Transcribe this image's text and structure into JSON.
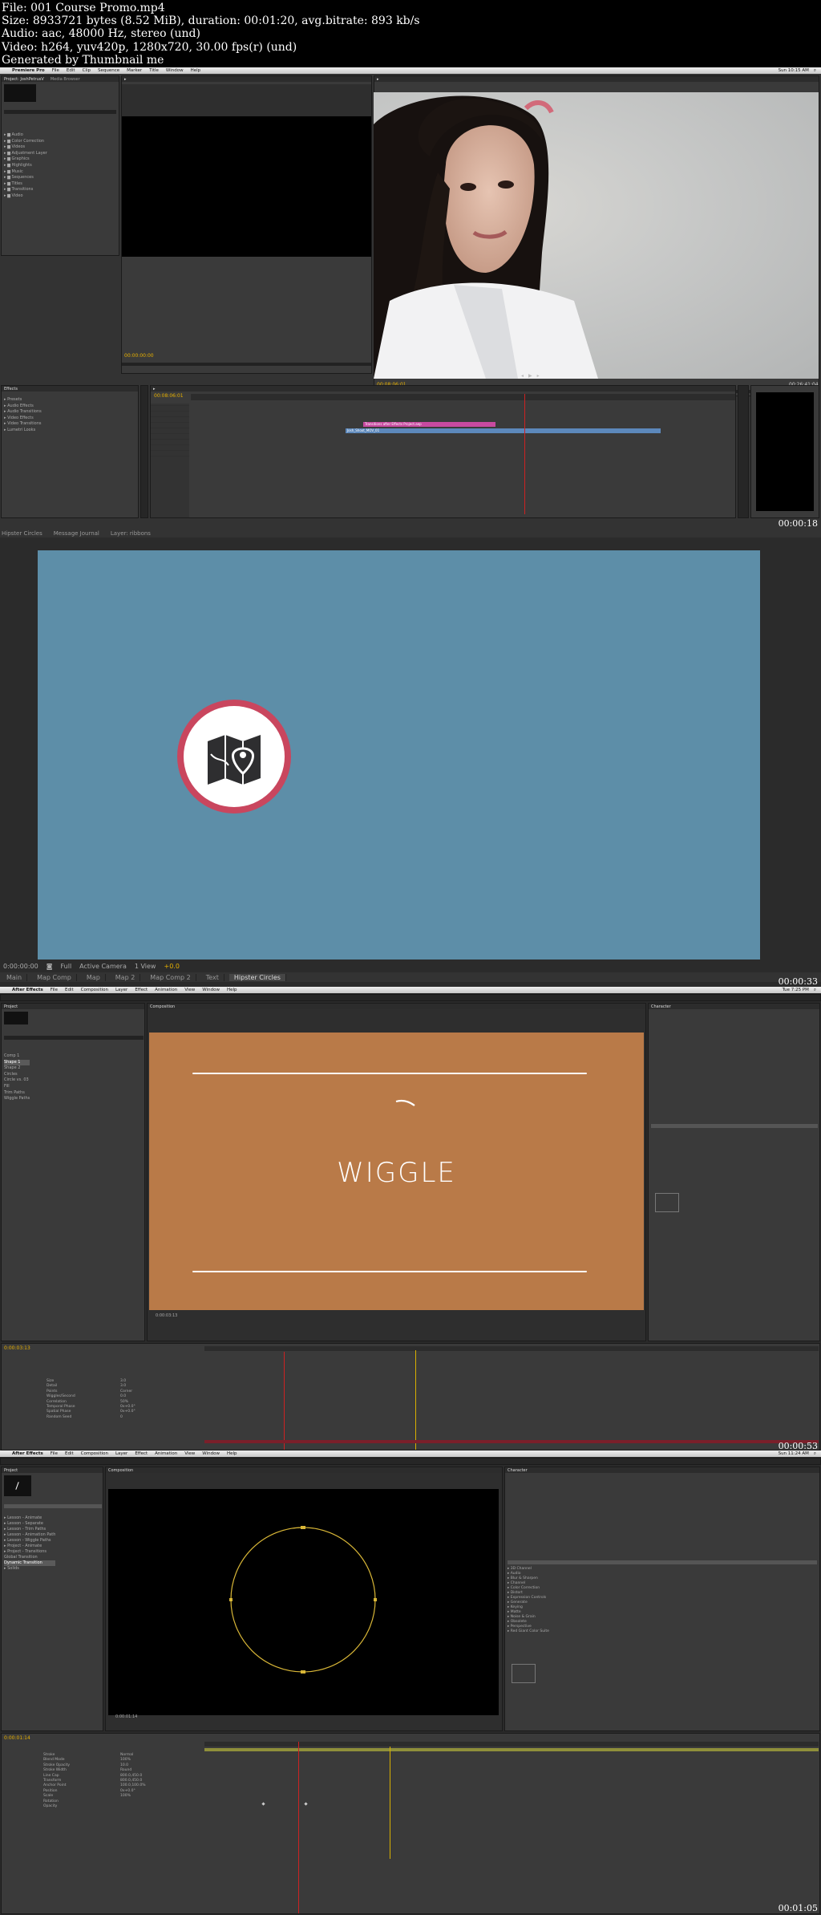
{
  "info": {
    "file": "File: 001 Course Promo.mp4",
    "size": "Size: 8933721 bytes (8.52 MiB), duration: 00:01:20, avg.bitrate: 893 kb/s",
    "audio": "Audio: aac, 48000 Hz, stereo (und)",
    "video": "Video: h264, yuv420p, 1280x720, 30.00 fps(r) (und)",
    "generated": "Generated by Thumbnail me"
  },
  "frames": {
    "f1": {
      "timestamp": "00:00:18",
      "menubar": {
        "app": "Premiere Pro",
        "items": [
          "File",
          "Edit",
          "Clip",
          "Sequence",
          "Marker",
          "Title",
          "Window",
          "Help"
        ],
        "clock": "Sun 10:15 AM"
      },
      "source_timecode": "00:00:00:00",
      "program_timecode": "00:08:06:01",
      "program_duration": "00:26:41:04",
      "timeline_timecode": "00:08:06:01",
      "project_tabs": [
        "Project: JoshPetrusV",
        "Media Browser",
        "Info"
      ],
      "bins": [
        "Audio",
        "Color Correction",
        "Videos",
        "Adjustment Layer",
        "Graphics",
        "Highlights",
        "Music",
        "Sequences",
        "Titles",
        "Transitions",
        "Video"
      ],
      "effects_tree": [
        "Presets",
        "Audio Effects",
        "Audio Transitions",
        "Video Effects",
        "Video Transitions",
        "Lumetri Looks"
      ],
      "clip_label_pink": "Transitions after Effects Project.aep",
      "clip_label_blue": "Josh_Shoot_MOV_01"
    },
    "f2": {
      "timestamp": "00:00:33",
      "tabs_top": [
        "Hipster Circles",
        "Message Journal",
        "Layer: ribbons"
      ],
      "tabs_bottom": [
        "Main",
        "Map Comp",
        "Map",
        "Map 2",
        "Map Comp 2",
        "Text",
        "Hipster Circles"
      ],
      "active_tab": "Hipster Circles",
      "viewer_timecode": "0:00:00:00",
      "viewer_quality": "Full",
      "camera": "Active Camera",
      "views": "1 View",
      "exposure": "+0.0",
      "badge_color": "#c9465e",
      "stage_color": "#5d8ea8"
    },
    "f3": {
      "timestamp": "00:00:53",
      "menubar": {
        "app": "After Effects",
        "items": [
          "File",
          "Edit",
          "Composition",
          "Layer",
          "Effect",
          "Animation",
          "View",
          "Window",
          "Help"
        ],
        "clock": "Tue 7:25 PM"
      },
      "comp_title": "WIGGLE",
      "layers": [
        "Comp 1",
        "Shape 1",
        "Shape 2",
        "Circles",
        "Circle vs. 03",
        "Fill",
        "Trim Paths",
        "Wiggle Paths"
      ],
      "wiggle_props": [
        "Size",
        "Detail",
        "Points",
        "Wiggles/Second",
        "Correlation",
        "Temporal Phase",
        "Spatial Phase",
        "Random Seed"
      ],
      "wiggle_values": [
        "3.0",
        "3.0",
        "Corner",
        "0.0",
        "50%",
        "0x+0.0°",
        "0x+0.0°",
        "0"
      ],
      "timecode": "0:00:03:13",
      "bg_color": "#b97a48"
    },
    "f4": {
      "timestamp": "00:01:05",
      "menubar": {
        "app": "After Effects",
        "items": [
          "File",
          "Edit",
          "Composition",
          "Layer",
          "Effect",
          "Animation",
          "View",
          "Window",
          "Help"
        ],
        "clock": "Sun 11:24 AM"
      },
      "project_items": [
        "Lesson - Animate",
        "Lesson - Separate",
        "Lesson - Trim Paths",
        "Lesson - Animation Path",
        "Lesson - Wiggle Paths",
        "Project - Animate",
        "Project - Transitions",
        "Global Transition",
        "Dynamic Transition",
        "Solids"
      ],
      "selected_project_item": "Dynamic Transition",
      "effects_list": [
        "3D Channel",
        "Audio",
        "Blur & Sharpen",
        "Channel",
        "Color Correction",
        "Distort",
        "Expression Controls",
        "Generate",
        "Keying",
        "Matte",
        "Noise & Grain",
        "Obsolete",
        "Perspective",
        "Red Giant Color Suite"
      ],
      "layer_props": [
        "Stroke",
        "Blend Mode",
        "Stroke Opacity",
        "Stroke Width",
        "Line Cap",
        "Transform",
        "Anchor Point",
        "Position",
        "Scale",
        "Rotation",
        "Opacity"
      ],
      "layer_values": [
        "",
        "Normal",
        "100%",
        "10.0",
        "Round",
        "",
        "800.0,450.0",
        "800.0,450.0",
        "100.0,100.0%",
        "0x+0.0°",
        "100%"
      ],
      "timecode": "0:00:01:14",
      "circle_color": "#d8b637"
    }
  }
}
